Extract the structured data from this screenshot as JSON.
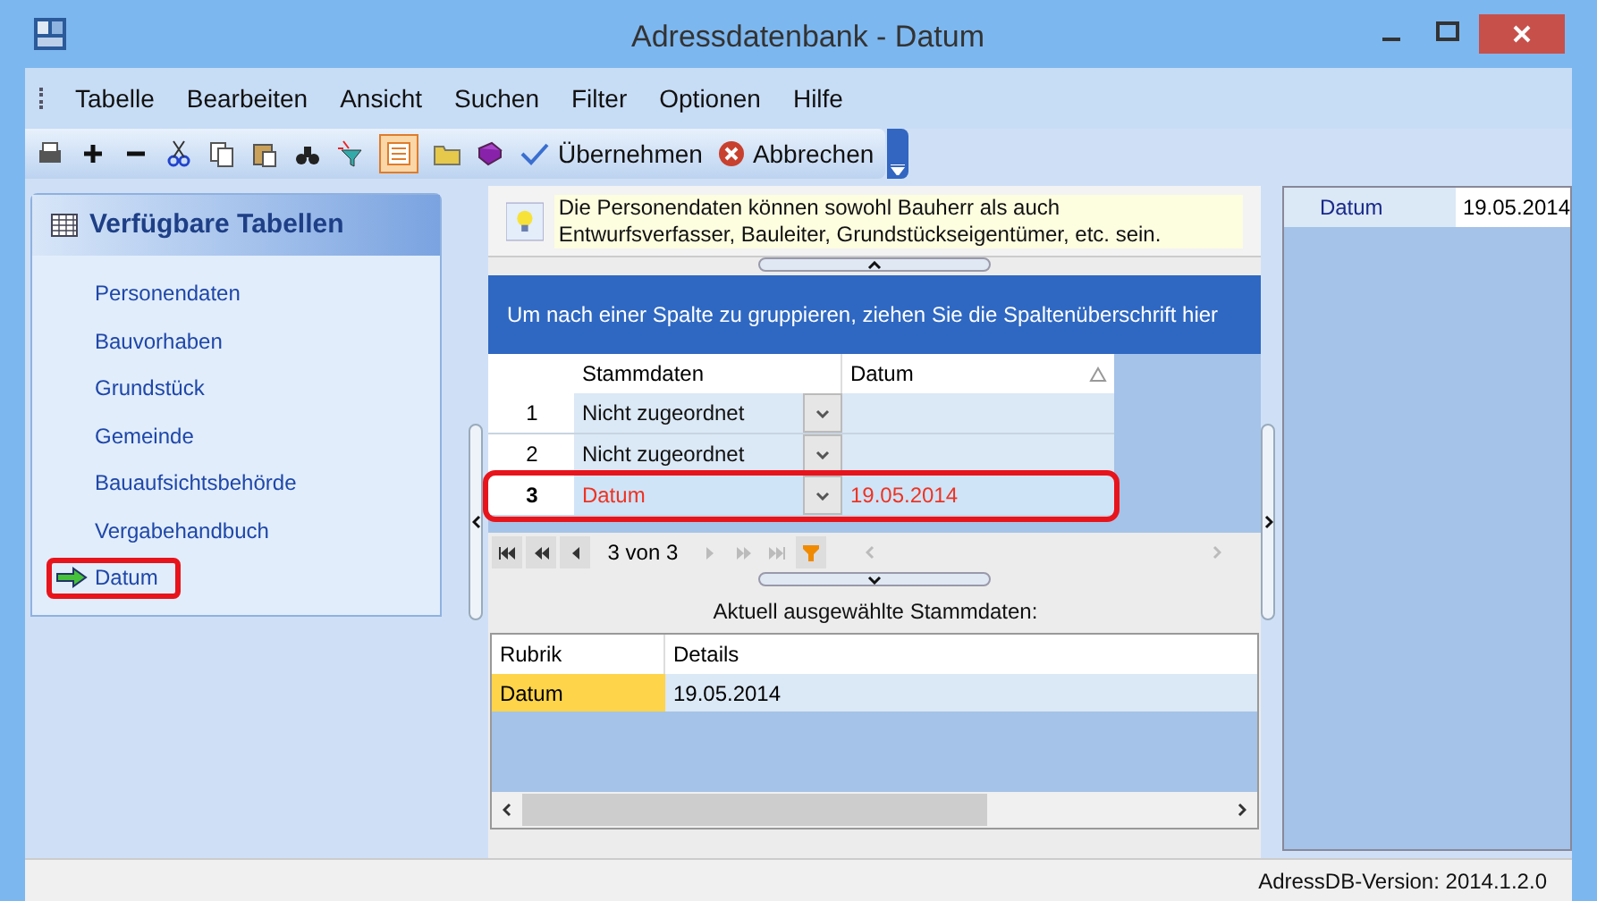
{
  "window": {
    "title": "Adressdatenbank - Datum"
  },
  "menu": [
    "Tabelle",
    "Bearbeiten",
    "Ansicht",
    "Suchen",
    "Filter",
    "Optionen",
    "Hilfe"
  ],
  "toolbar": {
    "view_toggle_on": true,
    "buttons": [
      {
        "kind": "ok",
        "label": "Übernehmen"
      },
      {
        "kind": "cancel",
        "label": "Abbrechen"
      }
    ]
  },
  "sidebar": {
    "title": "Verfügbare Tabellen",
    "items": [
      {
        "label": "Personendaten",
        "selected": false,
        "highlighted": false
      },
      {
        "label": "Bauvorhaben",
        "selected": false,
        "highlighted": false
      },
      {
        "label": "Grundstück",
        "selected": false,
        "highlighted": false
      },
      {
        "label": "Gemeinde",
        "selected": false,
        "highlighted": false
      },
      {
        "label": "Bauaufsichtsbehörde",
        "selected": false,
        "highlighted": false
      },
      {
        "label": "Vergabehandbuch",
        "selected": false,
        "highlighted": false
      },
      {
        "label": "Datum",
        "selected": true,
        "highlighted": true
      }
    ]
  },
  "hint": "Die Personendaten können sowohl Bauherr als auch Entwurfsverfasser, Bauleiter, Grundstückseigentümer, etc. sein.",
  "grid": {
    "group_panel": "Um nach einer Spalte zu gruppieren, ziehen Sie die Spaltenüberschrift hier",
    "columns": [
      "Stammdaten",
      "Datum"
    ],
    "rows": [
      {
        "number": "1",
        "stammdaten": "Nicht zugeordnet",
        "datum": "",
        "selected": false,
        "highlighted": false
      },
      {
        "number": "2",
        "stammdaten": "Nicht zugeordnet",
        "datum": "",
        "selected": false,
        "highlighted": false
      },
      {
        "number": "3",
        "stammdaten": "Datum",
        "datum": "19.05.2014",
        "selected": true,
        "highlighted": true
      }
    ],
    "navigator": "3 von 3"
  },
  "details": {
    "caption": "Aktuell ausgewählte Stammdaten:",
    "columns": [
      "Rubrik",
      "Details"
    ],
    "rows": [
      {
        "rubrik": "Datum",
        "details": "19.05.2014"
      }
    ]
  },
  "properties": [
    {
      "label": "Datum",
      "value": "19.05.2014"
    }
  ],
  "status_bar": {
    "version": "AdressDB-Version: 2014.1.2.0"
  }
}
